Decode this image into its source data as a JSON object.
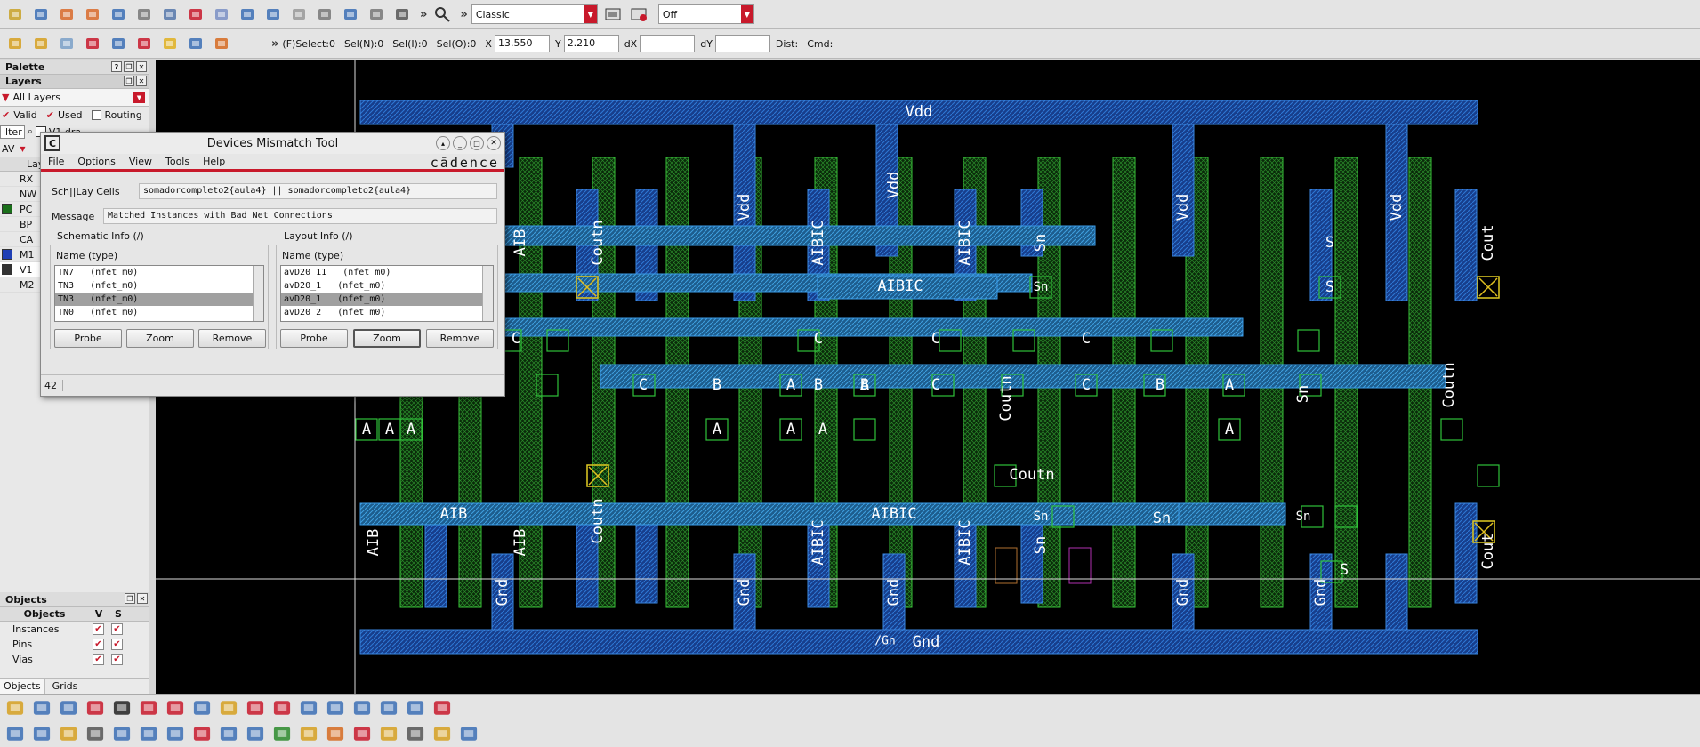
{
  "toolbar1": {
    "icons": [
      "open-icon",
      "save-icon",
      "undo-icon",
      "redo-icon",
      "move-icon",
      "copy-icon",
      "stretch-icon",
      "delete-icon",
      "properties-icon",
      "info-icon",
      "align-icon",
      "measure-icon",
      "label-icon",
      "create-wire-icon",
      "spell-icon",
      "via-icon",
      "zoom-icon"
    ],
    "workspace": "Classic",
    "drc_mode": "Off"
  },
  "toolbar2": {
    "icons": [
      "select-icon",
      "hand-icon",
      "create-inst-icon",
      "ruler-icon",
      "zoom-fit-icon",
      "pin-icon",
      "warn-icon",
      "path-icon",
      "markers-icon"
    ],
    "fselect": "(F)Select:0",
    "seln": "Sel(N):0",
    "seli": "Sel(I):0",
    "selo": "Sel(O):0",
    "x_label": "X",
    "x_value": "13.550",
    "y_label": "Y",
    "y_value": "2.210",
    "dx_label": "dX",
    "dx_value": "",
    "dy_label": "dY",
    "dy_value": "",
    "dist_label": "Dist:",
    "cmd_label": "Cmd:"
  },
  "palette": {
    "title": "Palette",
    "layers_title": "Layers",
    "filter_value": "All Layers",
    "valid": "Valid",
    "used": "Used",
    "routing": "Routing",
    "filter_btn": "ilter",
    "v1_row": "V1 dra",
    "av": "AV",
    "lay_header": "Lay",
    "layers": [
      {
        "name": "RX",
        "color": "#e8e8e8",
        "checked": false
      },
      {
        "name": "NW",
        "color": "#e8e8e8",
        "checked": false
      },
      {
        "name": "PC",
        "color": "#1a6f1a",
        "checked": true
      },
      {
        "name": "BP",
        "color": "#e8e8e8",
        "checked": false
      },
      {
        "name": "CA",
        "color": "#e8e8e8",
        "checked": false
      },
      {
        "name": "M1",
        "color": "#1f3fb5",
        "checked": true
      },
      {
        "name": "V1",
        "color": "#333",
        "checked": true
      },
      {
        "name": "M2",
        "color": "#e8e8e8",
        "checked": false
      }
    ]
  },
  "objects": {
    "title": "Objects",
    "col_objects": "Objects",
    "col_v": "V",
    "col_s": "S",
    "rows": [
      "Instances",
      "Pins",
      "Vias"
    ],
    "tabs": [
      "Objects",
      "Grids"
    ]
  },
  "canvas": {
    "labels": [
      "Vdd",
      "Gnd",
      "/Gn",
      "AIB",
      "AIBIC",
      "A|B",
      "Coutn",
      "Sn",
      "S",
      "Cout",
      "C",
      "B",
      "A"
    ]
  },
  "dmt": {
    "title": "Devices Mismatch Tool",
    "logo": "cādence",
    "menu": [
      "File",
      "Options",
      "View",
      "Tools",
      "Help"
    ],
    "cells_label": "Sch||Lay Cells",
    "cells_value": "somadorcompleto2{aula4}   ||   somadorcompleto2{aula4}",
    "message_label": "Message",
    "message_value": "Matched Instances with Bad Net Connections",
    "sch_info": "Schematic Info (/)",
    "lay_info": "Layout Info (/)",
    "col_header": "Name  (type)",
    "sch_rows": [
      "TN7   (nfet_m0)",
      "TN3   (nfet_m0)",
      "TN3   (nfet_m0)",
      "TN0   (nfet_m0)"
    ],
    "lay_rows": [
      "avD20_11   (nfet_m0)",
      "avD20_1   (nfet_m0)",
      "avD20_1   (nfet_m0)",
      "avD20_2   (nfet_m0)"
    ],
    "buttons": {
      "probe": "Probe",
      "zoom": "Zoom",
      "remove": "Remove"
    },
    "status": "42"
  },
  "bottom_toolbar": {
    "row1": [
      "hier-icon",
      "tree-icon",
      "layout-icon",
      "chip-icon",
      "grid-icon",
      "pin-icon",
      "barchart-icon",
      "probe-icon",
      "marker-icon",
      "route-icon",
      "net-icon",
      "select-box-icon",
      "select-icon",
      "zoom-box-icon",
      "zoom-in-icon",
      "pen-icon",
      "swap-icon"
    ],
    "row2": [
      "cell-icon",
      "save-icon",
      "bag-icon",
      "tools-icon",
      "link-icon",
      "fold-icon",
      "wire-icon",
      "mark-icon",
      "inst-icon",
      "search-icon",
      "snap-icon",
      "star-icon",
      "run-icon",
      "grid2-icon",
      "bulb-icon",
      "net2-icon",
      "ruler-icon",
      "plot-icon"
    ]
  },
  "colors": {
    "accent": "#c8192b",
    "metal1": "#1e6cc8",
    "poly": "#2fa52f",
    "canvas": "#000000"
  }
}
